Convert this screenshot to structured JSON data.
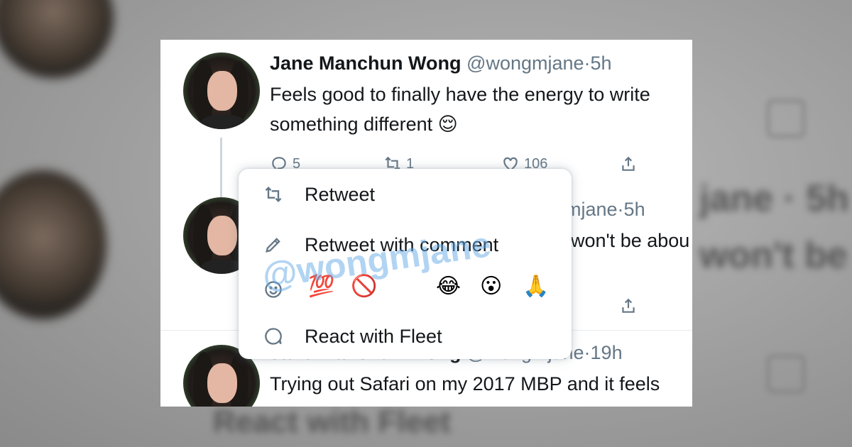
{
  "backdrop": {
    "text_1": "jane · 5h",
    "text_2": "won't be ab",
    "text_3": "React with Fleet"
  },
  "tweets": [
    {
      "name": "Jane Manchun Wong",
      "handle": "@wongmjane",
      "separator": "·",
      "time": "5h",
      "text_line_1": "Feels good to finally have the energy to write",
      "text_line_2": "something different 😌",
      "reply_count": "5",
      "retweet_count": "1",
      "like_count": "106"
    },
    {
      "name_partial": "mjane",
      "separator": "·",
      "time": "5h",
      "text_partial": "won't be abou"
    },
    {
      "name": "Jane Manchun Wong",
      "handle": "@wongmjane",
      "separator": "·",
      "time": "19h",
      "text": "Trying out Safari on my 2017 MBP and it feels"
    }
  ],
  "menu": {
    "retweet_label": "Retweet",
    "retweet_with_comment_label": "Retweet with comment",
    "emojis": [
      "💯",
      "🚫",
      "😂",
      "😮",
      "🙏"
    ],
    "react_fleet_label": "React with Fleet"
  },
  "watermark": "@wongmjane",
  "colors": {
    "text": "#14171a",
    "secondary": "#657786",
    "divider": "#e6ecf0",
    "watermark": "#64aae6"
  }
}
